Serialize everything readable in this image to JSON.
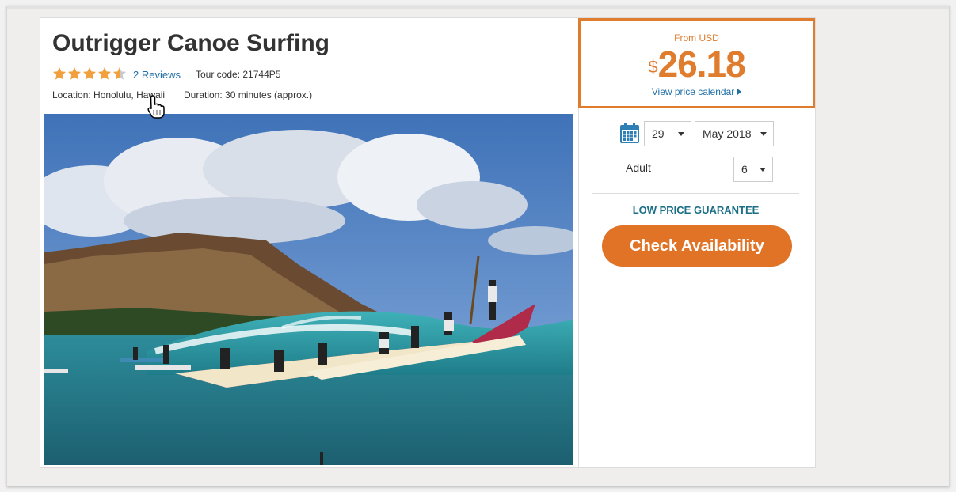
{
  "tour": {
    "title": "Outrigger Canoe Surfing",
    "rating": 4.5,
    "reviews_label": "2 Reviews",
    "tour_code": "Tour code: 21744P5",
    "location": "Location: Honolulu, Hawaii",
    "duration": "Duration: 30 minutes (approx.)"
  },
  "price": {
    "from_label": "From USD",
    "currency_symbol": "$",
    "amount": "26.18",
    "calendar_link": "View price calendar"
  },
  "booking": {
    "day": "29",
    "month": "May 2018",
    "adult_label": "Adult",
    "adult_count": "6",
    "guarantee": "LOW PRICE GUARANTEE",
    "check_button": "Check Availability"
  },
  "colors": {
    "accent": "#e07c2e",
    "button": "#e07326",
    "link": "#1f6fa6",
    "guarantee": "#1a6e86",
    "star": "#f2a03d"
  },
  "icons": {
    "star": "star-icon",
    "calendar": "calendar-icon",
    "cursor": "hand-cursor-icon"
  }
}
